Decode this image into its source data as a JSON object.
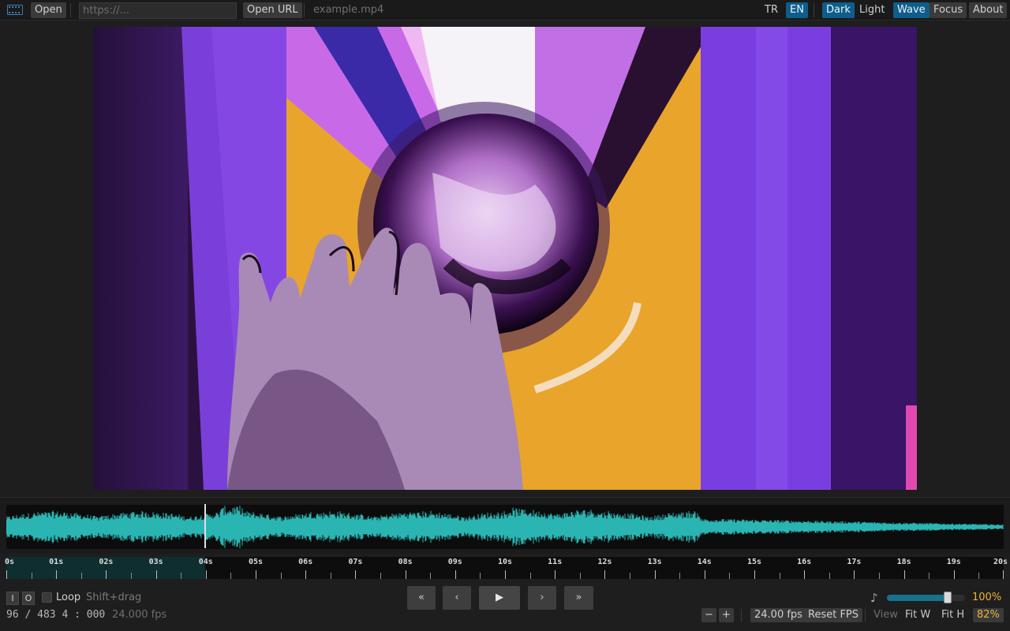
{
  "topbar": {
    "open_label": "Open",
    "url_placeholder": "https://...",
    "open_url_label": "Open URL",
    "filename": "example.mp4",
    "lang_tr": "TR",
    "lang_en": "EN",
    "theme_dark": "Dark",
    "theme_light": "Light",
    "wave_label": "Wave",
    "focus_label": "Focus",
    "about_label": "About"
  },
  "timeline": {
    "ticks": [
      "0s",
      "01s",
      "02s",
      "03s",
      "04s",
      "05s",
      "06s",
      "07s",
      "08s",
      "09s",
      "10s",
      "11s",
      "12s",
      "13s",
      "14s",
      "15s",
      "16s",
      "17s",
      "18s",
      "19s",
      "20s"
    ],
    "played_fraction": 0.2
  },
  "controls": {
    "in_label": "I",
    "out_label": "O",
    "loop_label": "Loop",
    "hint": "Shift+drag",
    "btn_first": "«",
    "btn_prev": "‹",
    "btn_play": "▶",
    "btn_next": "›",
    "btn_last": "»",
    "frame_readout": "96 / 483 4 : 000",
    "fps_readout": "24.000 fps",
    "volume_pct": "100%",
    "volume_value": 0.78,
    "zoom_minus": "−",
    "zoom_plus": "+",
    "fps_value": "24.00 fps",
    "reset_fps": "Reset FPS",
    "view_label": "View",
    "fit_w": "Fit W",
    "fit_h": "Fit H",
    "zoom_pct": "82%"
  },
  "colors": {
    "accent": "#0e5d8a",
    "wave": "#2ab5b3",
    "volume_fill": "#17718f",
    "zoom_pct": "#f0b43a"
  },
  "icons": {
    "app_logo": "film-strip-icon",
    "volume": "music-note-icon"
  }
}
